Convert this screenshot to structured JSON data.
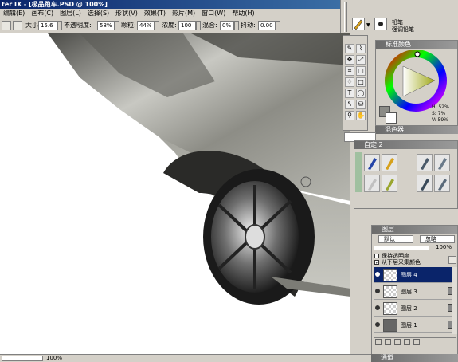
{
  "window": {
    "title": "ter IX - [极品跑车.PSD @ 100%]"
  },
  "menu": [
    "编辑(E)",
    "画布(C)",
    "图层(L)",
    "选择(S)",
    "形状(V)",
    "效果(T)",
    "影片(M)",
    "窗口(W)",
    "帮助(H)"
  ],
  "props": {
    "size_label": "大小:",
    "size_value": "15.6",
    "opacity_label": "不透明度:",
    "opacity_value": "58%",
    "grain_label": "颗粒:",
    "grain_value": "44%",
    "resat_label": "浓度:",
    "resat_value": "100",
    "blend_label": "混合:",
    "blend_value": "0%",
    "jitter_label": "抖动:",
    "jitter_value": "0.00"
  },
  "brush": {
    "category": "铅笔",
    "variant": "强调铅笔"
  },
  "color_panel": {
    "title": "标准颜色",
    "h": "H: 52%",
    "s": "S: 7%",
    "v": "V: 59%"
  },
  "mixer_panel": {
    "title": "混色器"
  },
  "custom_panel": {
    "title": "自定 2"
  },
  "layers_panel": {
    "title": "图层",
    "composite": "默认",
    "method": "忽略",
    "opacity": "100%",
    "preserve": "保持透明度",
    "pick": "从下层采集颜色",
    "layers": [
      {
        "name": "图层 4",
        "selected": true
      },
      {
        "name": "图层 3",
        "selected": false
      },
      {
        "name": "图层 2",
        "selected": false
      },
      {
        "name": "图层 1",
        "selected": false
      }
    ]
  },
  "channels_panel": {
    "title": "通道"
  },
  "status": {
    "zoom": "100%"
  },
  "colors": {
    "title_bar": "#0a246a",
    "selection": "#0a246a",
    "chrome": "#d4d0c8"
  }
}
